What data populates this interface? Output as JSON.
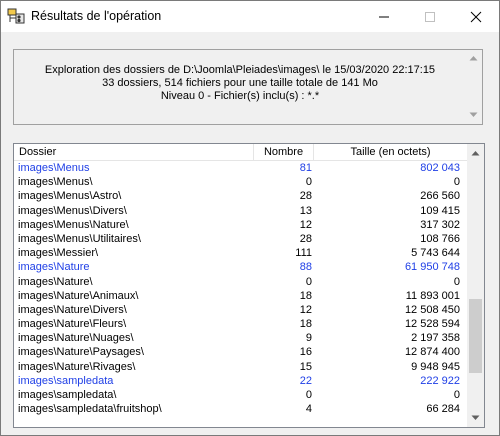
{
  "window": {
    "title": "Résultats de l'opération"
  },
  "info": {
    "line1": "Exploration des dossiers de D:\\Joomla\\Pleiades\\images\\ le 15/03/2020 22:17:15",
    "line2": "33 dossiers, 514 fichiers  pour une taille totale de 141 Mo",
    "line3": "Niveau 0 - Fichier(s) inclu(s) : *.*"
  },
  "table": {
    "columns": [
      "Dossier",
      "Nombre",
      "Taille (en octets)"
    ],
    "rows": [
      {
        "folder": "images\\Menus",
        "count": "81",
        "size": "802 043",
        "highlight": true
      },
      {
        "folder": "images\\Menus\\",
        "count": "0",
        "size": "0",
        "highlight": false
      },
      {
        "folder": "images\\Menus\\Astro\\",
        "count": "28",
        "size": "266 560",
        "highlight": false
      },
      {
        "folder": "images\\Menus\\Divers\\",
        "count": "13",
        "size": "109 415",
        "highlight": false
      },
      {
        "folder": "images\\Menus\\Nature\\",
        "count": "12",
        "size": "317 302",
        "highlight": false
      },
      {
        "folder": "images\\Menus\\Utilitaires\\",
        "count": "28",
        "size": "108 766",
        "highlight": false
      },
      {
        "folder": "images\\Messier\\",
        "count": "111",
        "size": "5 743 644",
        "highlight": false
      },
      {
        "folder": "images\\Nature",
        "count": "88",
        "size": "61 950 748",
        "highlight": true
      },
      {
        "folder": "images\\Nature\\",
        "count": "0",
        "size": "0",
        "highlight": false
      },
      {
        "folder": "images\\Nature\\Animaux\\",
        "count": "18",
        "size": "11 893 001",
        "highlight": false
      },
      {
        "folder": "images\\Nature\\Divers\\",
        "count": "12",
        "size": "12 508 450",
        "highlight": false
      },
      {
        "folder": "images\\Nature\\Fleurs\\",
        "count": "18",
        "size": "12 528 594",
        "highlight": false
      },
      {
        "folder": "images\\Nature\\Nuages\\",
        "count": "9",
        "size": "2 197 358",
        "highlight": false
      },
      {
        "folder": "images\\Nature\\Paysages\\",
        "count": "16",
        "size": "12 874 400",
        "highlight": false
      },
      {
        "folder": "images\\Nature\\Rivages\\",
        "count": "15",
        "size": "9 948 945",
        "highlight": false
      },
      {
        "folder": "images\\sampledata",
        "count": "22",
        "size": "222 922",
        "highlight": true
      },
      {
        "folder": "images\\sampledata\\",
        "count": "0",
        "size": "0",
        "highlight": false
      },
      {
        "folder": "images\\sampledata\\fruitshop\\",
        "count": "4",
        "size": "66 284",
        "highlight": false
      }
    ]
  },
  "colors": {
    "highlight_row": "#1f3fe6",
    "scroll_thumb": "#cdcdcd"
  },
  "icons": [
    "app-icon",
    "minimize-icon",
    "maximize-icon",
    "close-icon",
    "scroll-up-icon",
    "scroll-down-icon"
  ]
}
